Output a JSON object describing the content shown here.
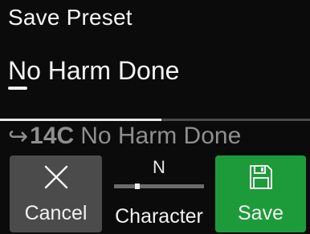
{
  "header": {
    "title": "Save Preset"
  },
  "preset_name": {
    "value": "No Harm Done"
  },
  "progress": {
    "fraction": 0.52
  },
  "destination": {
    "arrow": "↪",
    "slot": "14C",
    "name": "No Harm Done"
  },
  "buttons": {
    "cancel_label": "Cancel",
    "save_label": "Save"
  },
  "character": {
    "value": "N",
    "label": "Character",
    "position_fraction": 0.26
  },
  "colors": {
    "save_accent": "#1d9b3a",
    "cancel_bg": "#4b4b4b",
    "background": "#0b0b0b"
  }
}
